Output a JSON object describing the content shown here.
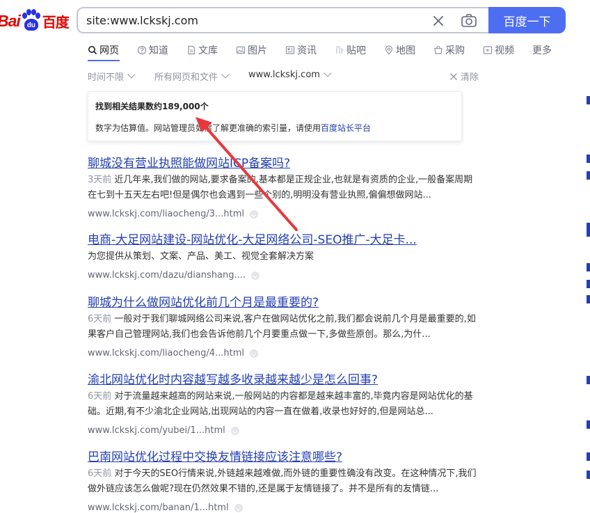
{
  "logo": {
    "text_bai": "Bai",
    "text_du": "du",
    "text_cn": "百度"
  },
  "search": {
    "value": "site:www.lckskj.com",
    "button_label": "百度一下"
  },
  "icons": {
    "clear": "close-icon",
    "camera": "camera-icon"
  },
  "tabs": [
    {
      "label": "网页",
      "icon": "search-icon",
      "active": true
    },
    {
      "label": "知道",
      "icon": "question-icon"
    },
    {
      "label": "文库",
      "icon": "document-icon"
    },
    {
      "label": "图片",
      "icon": "image-icon"
    },
    {
      "label": "资讯",
      "icon": "news-icon"
    },
    {
      "label": "贴吧",
      "icon": "tieba-icon"
    },
    {
      "label": "地图",
      "icon": "map-pin-icon"
    },
    {
      "label": "采购",
      "icon": "cart-icon"
    },
    {
      "label": "视频",
      "icon": "video-icon"
    },
    {
      "label": "更多"
    }
  ],
  "filters": {
    "time": "时间不限",
    "type": "所有网页和文件",
    "site": "www.lckskj.com",
    "clear": "清除"
  },
  "hint": {
    "title": "找到相关结果数约189,000个",
    "desc": "数字为估算值。网站管理员如需了解更准确的索引量，请使用",
    "link": "百度站长平台"
  },
  "results": [
    {
      "title": "聊城没有营业执照能做网站ICP备案吗?",
      "time": "3天前",
      "abstract": "近几年来,我们做的网站,要求备案的,基本都是正规企业,也就是有资质的企业,一般备案周期在七到十五天左右吧!但是偶尔也会遇到一些个别的,明明没有营业执照,偏偏想做网站...",
      "url": "www.lckskj.com/liaocheng/3...html"
    },
    {
      "title": "电商-大足网站建设-网站优化-大足网络公司-SEO推广-大足卡...",
      "time": "",
      "abstract": "为您提供从策划、文案、产品、美工、视觉全套解决方案",
      "url": "www.lckskj.com/dazu/dianshang...."
    },
    {
      "title": "聊城为什么做网站优化前几个月是最重要的?",
      "time": "6天前",
      "abstract": "一般对于我们聊城网络公司来说,客户在做网站优化之前,我们都会说前几个月是最重要的,如果客户自己管理网站,我们也会告诉他前几个月要重点做一下,多做些原创。那么,为什...",
      "url": "www.lckskj.com/liaocheng/4...html"
    },
    {
      "title": "渝北网站优化时内容越写越多收录越来越少是怎么回事?",
      "time": "6天前",
      "abstract": "对于流量越来越高的网站来说,一般网站的内容都是越来越丰富的,毕竟内容是网站优化的基础。近期,有不少渝北企业网站,出现网站的内容一直在做着,收录也好好的,但是网站总...",
      "url": "www.lckskj.com/yubei/1...html"
    },
    {
      "title": "巴南网站优化过程中交换友情链接应该注意哪些?",
      "time": "6天前",
      "abstract": "对于今天的SEO行情来说,外链越来越难做,而外链的重要性确没有改变。在这种情况下,我们做外链应该怎么做呢?现在仍然效果不错的,还是属于友情链接了。并不是所有的友情链...",
      "url": "www.lckskj.com/banan/1...html"
    }
  ],
  "colors": {
    "brand_blue": "#4e6ef2",
    "link_blue": "#2440b3",
    "logo_red": "#e10602",
    "arrow_red": "#e8383d"
  }
}
